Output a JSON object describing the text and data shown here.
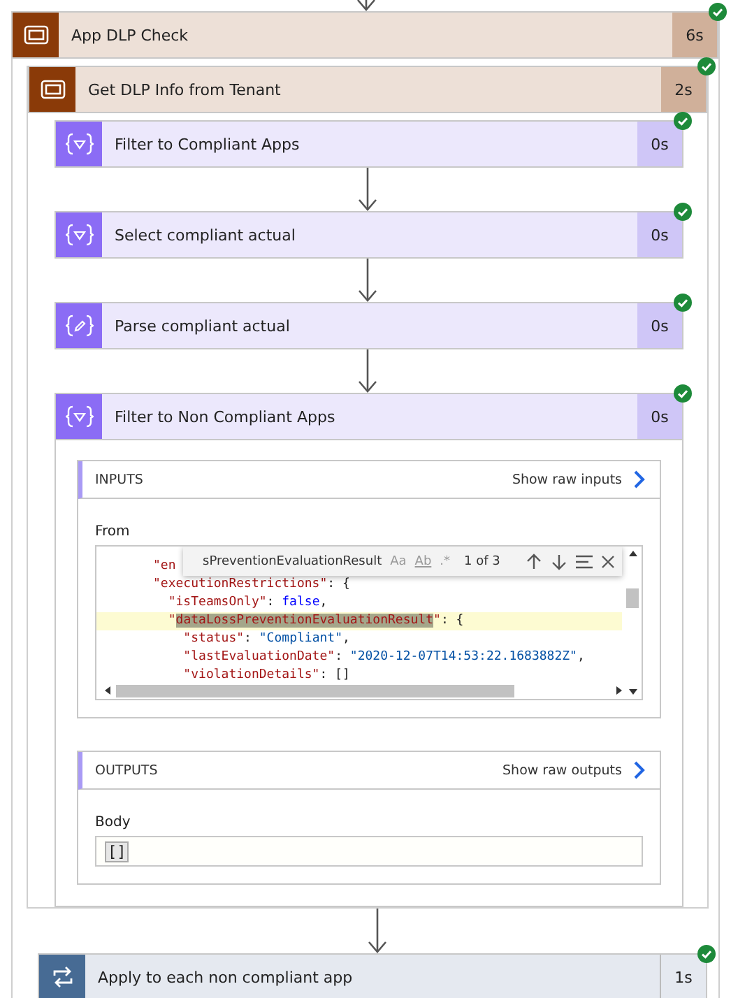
{
  "scope": {
    "kind": "scope",
    "title": "App DLP Check",
    "duration": "6s",
    "succeeded": true,
    "inner_scope": {
      "kind": "scope",
      "title": "Get DLP Info from Tenant",
      "duration": "2s",
      "succeeded": true,
      "actions": [
        {
          "kind": "filter",
          "title": "Filter to Compliant Apps",
          "duration": "0s",
          "succeeded": true
        },
        {
          "kind": "filter",
          "title": "Select compliant actual",
          "duration": "0s",
          "succeeded": true
        },
        {
          "kind": "parse",
          "title": "Parse compliant actual",
          "duration": "0s",
          "succeeded": true
        },
        {
          "kind": "filter",
          "title": "Filter to Non Compliant Apps",
          "duration": "0s",
          "succeeded": true,
          "details": {
            "inputs": {
              "heading": "INPUTS",
              "raw_link": "Show raw inputs",
              "field_label": "From",
              "find": {
                "query": "sPreventionEvaluationResult",
                "options": [
                  "Aa",
                  "Ab",
                  ".*"
                ],
                "count": "1 of 3"
              },
              "code_lines": [
                {
                  "current": false,
                  "tokens": [
                    {
                      "kind": "key",
                      "text": "      \"en"
                    }
                  ]
                },
                {
                  "current": false,
                  "tokens": [
                    {
                      "kind": "key",
                      "text": "      \"executionRestrictions\""
                    },
                    {
                      "kind": "punct",
                      "text": ": {"
                    }
                  ]
                },
                {
                  "current": false,
                  "tokens": [
                    {
                      "kind": "key",
                      "text": "        \"isTeamsOnly\""
                    },
                    {
                      "kind": "punct",
                      "text": ": "
                    },
                    {
                      "kind": "keyword",
                      "text": "false"
                    },
                    {
                      "kind": "punct",
                      "text": ","
                    }
                  ]
                },
                {
                  "current": true,
                  "tokens": [
                    {
                      "kind": "key",
                      "text": "        \""
                    },
                    {
                      "kind": "match",
                      "text": "dataLossPreventionEvaluationResult"
                    },
                    {
                      "kind": "key",
                      "text": "\""
                    },
                    {
                      "kind": "punct",
                      "text": ": {"
                    }
                  ]
                },
                {
                  "current": false,
                  "tokens": [
                    {
                      "kind": "key",
                      "text": "          \"status\""
                    },
                    {
                      "kind": "punct",
                      "text": ": "
                    },
                    {
                      "kind": "string",
                      "text": "\"Compliant\""
                    },
                    {
                      "kind": "punct",
                      "text": ","
                    }
                  ]
                },
                {
                  "current": false,
                  "tokens": [
                    {
                      "kind": "key",
                      "text": "          \"lastEvaluationDate\""
                    },
                    {
                      "kind": "punct",
                      "text": ": "
                    },
                    {
                      "kind": "string",
                      "text": "\"2020-12-07T14:53:22.1683882Z\""
                    },
                    {
                      "kind": "punct",
                      "text": ","
                    }
                  ]
                },
                {
                  "current": false,
                  "tokens": [
                    {
                      "kind": "key",
                      "text": "          \"violationDetails\""
                    },
                    {
                      "kind": "punct",
                      "text": ": []"
                    }
                  ]
                }
              ]
            },
            "outputs": {
              "heading": "OUTPUTS",
              "raw_link": "Show raw outputs",
              "field_label": "Body",
              "value": "[]"
            }
          }
        }
      ]
    }
  },
  "next_action": {
    "kind": "foreach",
    "title": "Apply to each non compliant app",
    "duration": "1s",
    "succeeded": true
  }
}
